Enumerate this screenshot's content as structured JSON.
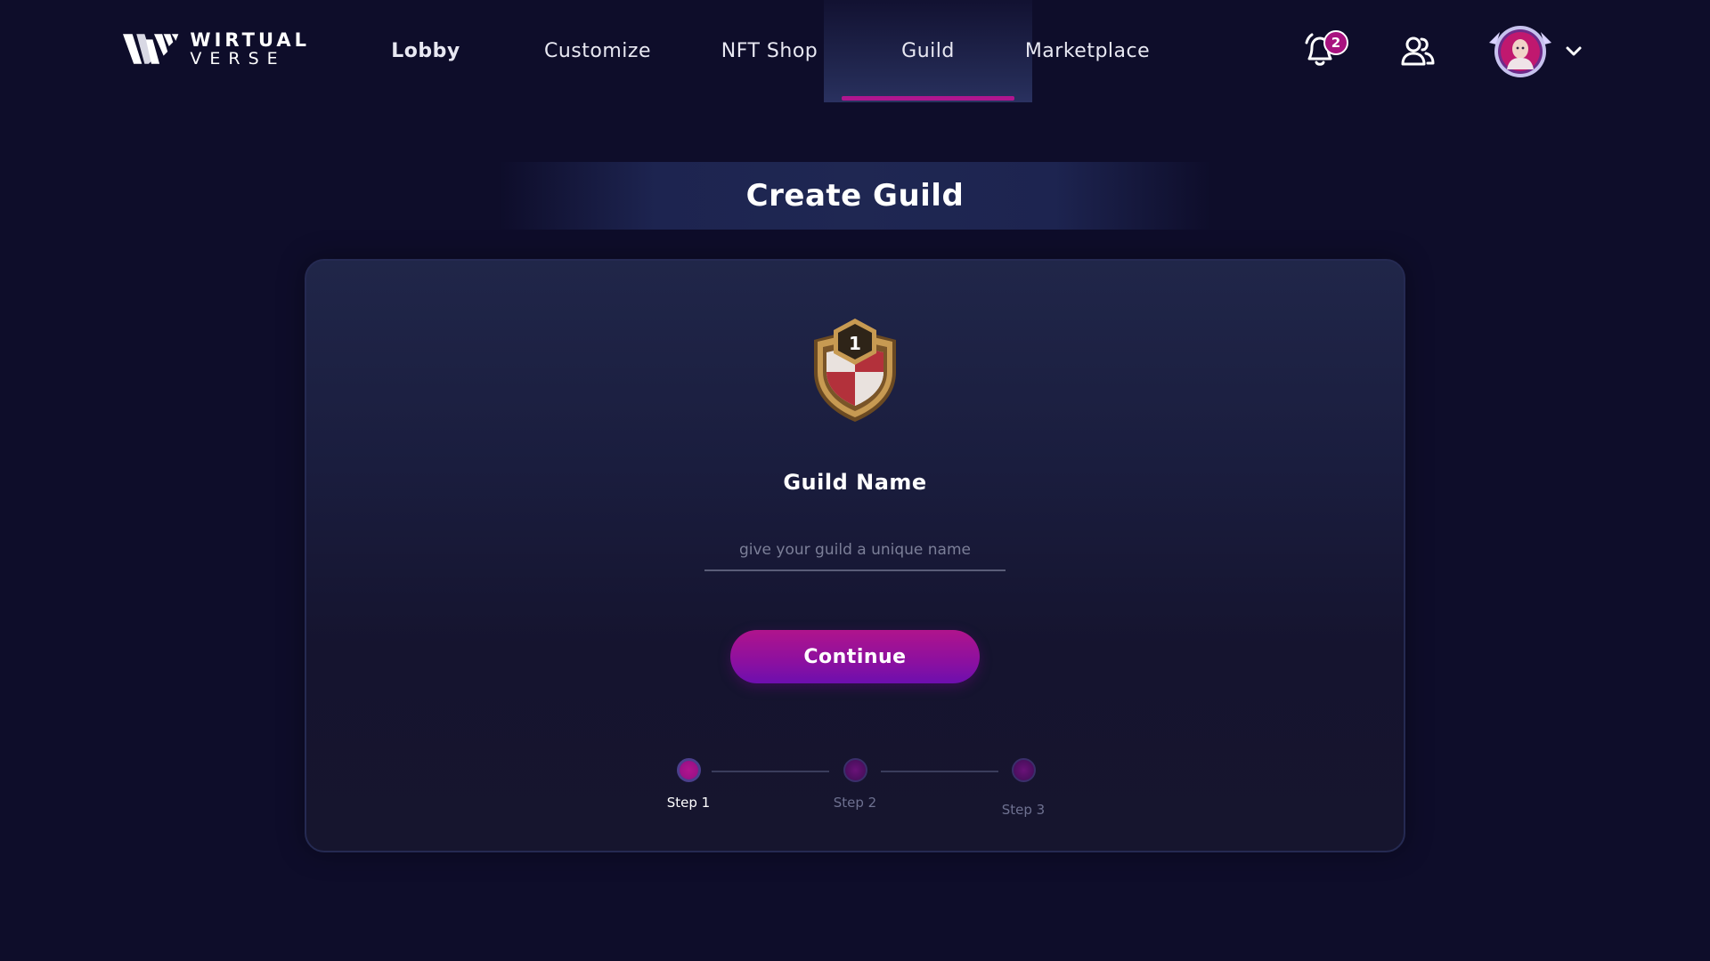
{
  "brand": {
    "line1": "WIRTUAL",
    "line2": "VERSE"
  },
  "nav": {
    "items": [
      {
        "label": "Lobby",
        "active": false
      },
      {
        "label": "Customize",
        "active": false
      },
      {
        "label": "NFT Shop",
        "active": false
      },
      {
        "label": "Guild",
        "active": true
      },
      {
        "label": "Marketplace",
        "active": false
      }
    ]
  },
  "header": {
    "notification_count": "2",
    "icons": [
      "bell-icon",
      "friends-icon",
      "avatar",
      "chevron-down-icon"
    ]
  },
  "page": {
    "title": "Create Guild"
  },
  "form": {
    "guild_name_label": "Guild Name",
    "guild_name_value": "",
    "guild_name_placeholder": "give your guild a unique name",
    "continue_label": "Continue",
    "badge_number": "1"
  },
  "steps": {
    "items": [
      {
        "label": "Step 1",
        "active": true
      },
      {
        "label": "Step 2",
        "active": false
      },
      {
        "label": "Step 3",
        "active": false
      }
    ]
  },
  "colors": {
    "background": "#0e0d2a",
    "accent": "#b0168f",
    "card": "#1a1d3e"
  }
}
